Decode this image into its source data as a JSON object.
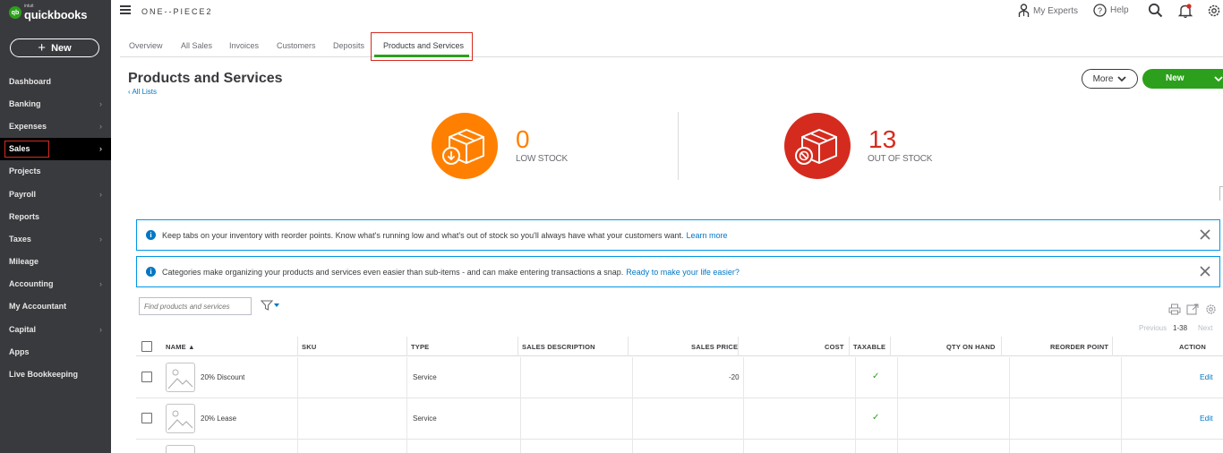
{
  "sidebar": {
    "logo": {
      "intuit": "intuit",
      "brand": "quickbooks",
      "mark": "qb"
    },
    "new_button": {
      "label": "New"
    },
    "items": [
      {
        "label": "Dashboard",
        "chevron": false
      },
      {
        "label": "Banking",
        "chevron": true
      },
      {
        "label": "Expenses",
        "chevron": true
      },
      {
        "label": "Sales",
        "chevron": true,
        "active": true
      },
      {
        "label": "Projects",
        "chevron": false
      },
      {
        "label": "Payroll",
        "chevron": true
      },
      {
        "label": "Reports",
        "chevron": false
      },
      {
        "label": "Taxes",
        "chevron": true
      },
      {
        "label": "Mileage",
        "chevron": false
      },
      {
        "label": "Accounting",
        "chevron": true
      },
      {
        "label": "My Accountant",
        "chevron": false
      },
      {
        "label": "Capital",
        "chevron": true
      },
      {
        "label": "Apps",
        "chevron": false
      },
      {
        "label": "Live Bookkeeping",
        "chevron": false
      }
    ]
  },
  "header": {
    "company_name": "ONE--PIECE2",
    "my_experts": "My Experts",
    "help": "Help"
  },
  "tabs": [
    {
      "label": "Overview"
    },
    {
      "label": "All Sales"
    },
    {
      "label": "Invoices"
    },
    {
      "label": "Customers"
    },
    {
      "label": "Deposits"
    },
    {
      "label": "Products and Services",
      "active": true
    }
  ],
  "page": {
    "title": "Products and Services",
    "back_link": "All Lists",
    "more_button": "More",
    "new_button": "New"
  },
  "stats": {
    "low_stock": {
      "value": "0",
      "label": "LOW STOCK",
      "color": "#ff8000"
    },
    "out_of_stock": {
      "value": "13",
      "label": "OUT OF STOCK",
      "color": "#d52b1e"
    }
  },
  "banners": [
    {
      "text": "Keep tabs on your inventory with reorder points. Know what's running low and what's out of stock so you'll always have what your customers want.",
      "link": "Learn more"
    },
    {
      "text": "Categories make organizing your products and services even easier than sub-items - and can make entering transactions a snap.",
      "link": "Ready to make your life easier?"
    }
  ],
  "search": {
    "placeholder": "Find products and services"
  },
  "pager": {
    "previous": "Previous",
    "range": "1-38",
    "next": "Next"
  },
  "table": {
    "columns": [
      "NAME ▲",
      "SKU",
      "TYPE",
      "SALES DESCRIPTION",
      "SALES PRICE",
      "COST",
      "TAXABLE",
      "QTY ON HAND",
      "REORDER POINT",
      "ACTION"
    ],
    "rows": [
      {
        "name": "20% Discount",
        "sku": "",
        "type": "Service",
        "sales_description": "",
        "sales_price": "-20",
        "cost": "",
        "taxable": "✓",
        "qty_on_hand": "",
        "reorder_point": "",
        "action": "Edit"
      },
      {
        "name": "20% Lease",
        "sku": "",
        "type": "Service",
        "sales_description": "",
        "sales_price": "",
        "cost": "",
        "taxable": "✓",
        "qty_on_hand": "",
        "reorder_point": "",
        "action": "Edit"
      }
    ]
  },
  "colors": {
    "brand_green": "#2ca01c",
    "link_blue": "#0077c5",
    "sidebar_bg": "#393a3d",
    "highlight_red": "#d52b1e"
  }
}
